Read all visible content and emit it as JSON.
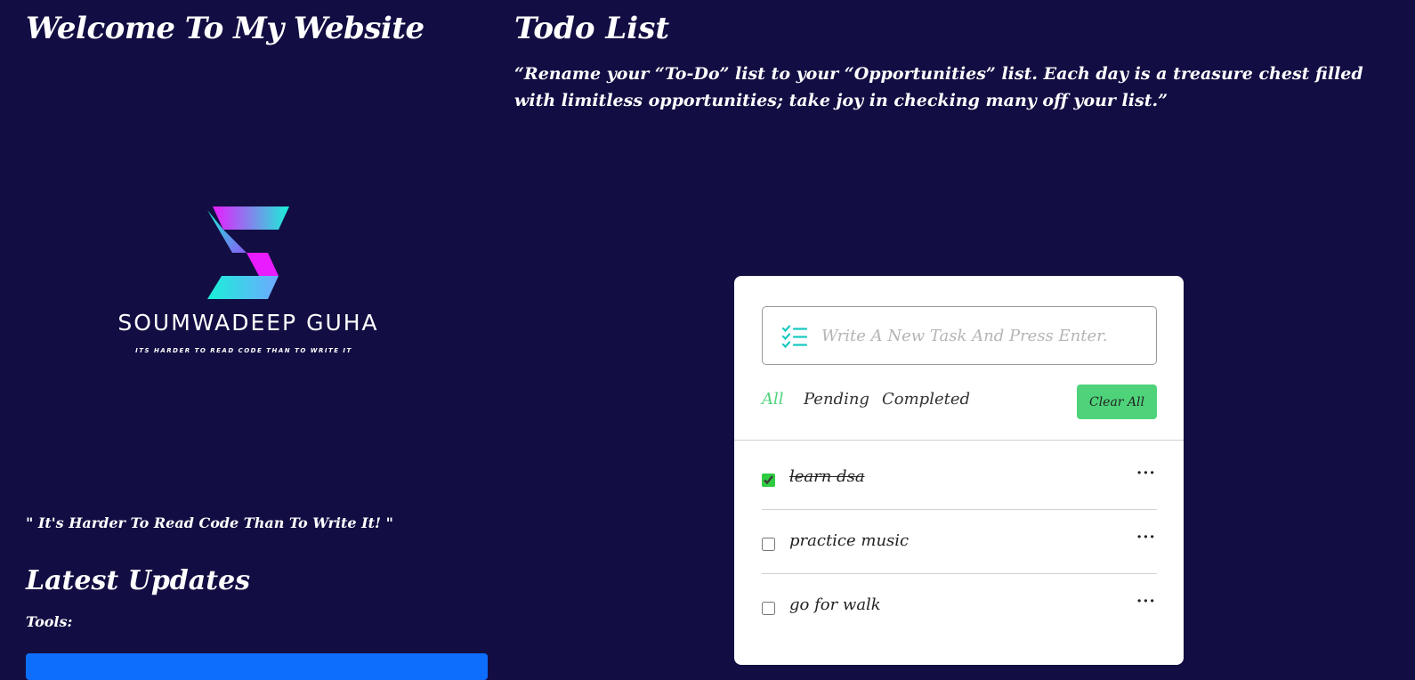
{
  "left": {
    "site_title": "Welcome To My Website",
    "logo": {
      "name": "SOUMWADEEP GUHA",
      "tagline": "ITS HARDER TO READ CODE THAN TO WRITE IT",
      "colors": {
        "cyan": "#19f0d8",
        "magenta": "#e81cff",
        "violet": "#8a5cf6"
      }
    },
    "quote": "\" It's Harder To Read Code Than To Write It! \"",
    "updates_title": "Latest Updates",
    "tools_label": "Tools:"
  },
  "todo": {
    "title": "Todo List",
    "quote": "“Rename your “To-Do” list to your “Opportunities” list. Each day is a treasure chest filled with limitless opportunities; take joy in checking many off your list.”",
    "input": {
      "placeholder": "Write A New Task And Press Enter.",
      "value": "",
      "icon": "list-check-icon"
    },
    "filters": [
      {
        "label": "All",
        "active": true
      },
      {
        "label": "Pending",
        "active": false
      },
      {
        "label": "Completed",
        "active": false
      }
    ],
    "clear_label": "Clear All",
    "tasks": [
      {
        "label": "learn dsa",
        "checked": true,
        "menu": "···"
      },
      {
        "label": "practice music",
        "checked": false,
        "menu": "···"
      },
      {
        "label": "go for walk",
        "checked": false,
        "menu": "···"
      }
    ]
  },
  "colors": {
    "background": "#120e43",
    "accent_green": "#4fd37a",
    "link_blue": "#0d6efd"
  }
}
